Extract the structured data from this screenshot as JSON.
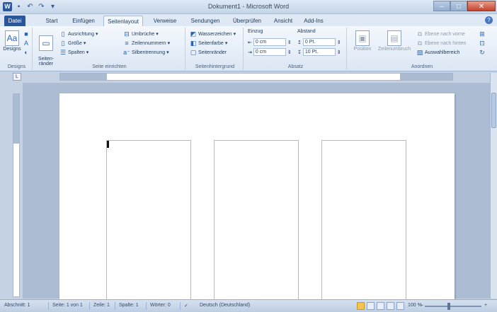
{
  "window": {
    "title": "Dokument1 - Microsoft Word",
    "controls": [
      "–",
      "□",
      "✕"
    ]
  },
  "qat": {
    "logo": "W",
    "items": [
      "save-icon",
      "undo-icon",
      "redo-icon",
      "customize-icon"
    ]
  },
  "tabs": [
    {
      "label": "Datei",
      "name": "tab-datei"
    },
    {
      "label": "Start",
      "name": "tab-start"
    },
    {
      "label": "Einfügen",
      "name": "tab-einfuegen"
    },
    {
      "label": "Seitenlayout",
      "name": "tab-seitenlayout"
    },
    {
      "label": "Verweise",
      "name": "tab-verweise"
    },
    {
      "label": "Sendungen",
      "name": "tab-sendungen"
    },
    {
      "label": "Überprüfen",
      "name": "tab-ueberpruefen"
    },
    {
      "label": "Ansicht",
      "name": "tab-ansicht"
    },
    {
      "label": "Add-Ins",
      "name": "tab-addins"
    }
  ],
  "active_tab": "Seitenlayout",
  "ribbon": {
    "designs": {
      "label": "Designs",
      "button": "Designs"
    },
    "seite_einrichten": {
      "label": "Seite einrichten",
      "seitenraender": "Seiten-\nränder",
      "ausrichtung": "Ausrichtung",
      "groesse": "Größe",
      "spalten": "Spalten",
      "umbrueche": "Umbrüche",
      "zeilennummern": "Zeilennummern",
      "silbentrennung": "Silbentrennung"
    },
    "seitenhintergrund": {
      "label": "Seitenhintergrund",
      "wasserzeichen": "Wasserzeichen",
      "seitenfarbe": "Seitenfarbe",
      "seitenraender": "Seitenränder"
    },
    "absatz": {
      "label": "Absatz",
      "einzug": "Einzug",
      "abstand": "Abstand",
      "einzug_links": "0 cm",
      "einzug_rechts": "0 cm",
      "abstand_vor": "0 Pt.",
      "abstand_nach": "10 Pt."
    },
    "anordnen": {
      "label": "Anordnen",
      "position": "Position",
      "zeilenumbruch": "Zeilenumbruch",
      "ebene_nach_vorne": "Ebene nach vorne",
      "ebene_nach_hinten": "Ebene nach hinten",
      "auswahlbereich": "Auswahlbereich"
    }
  },
  "document": {
    "columns": 3
  },
  "statusbar": {
    "wort": "Wörter: 0",
    "abschnitt": "Abschnitt: 1",
    "seite": "Seite: 1 von 1",
    "zeile": "Zeile: 1",
    "spalte": "Spalte: 1",
    "sprache": "Deutsch (Deutschland)",
    "zoom": "100 %",
    "zoom_minus": "–",
    "zoom_plus": "+"
  },
  "colors": {
    "file_tab": "#2b579a",
    "ribbon_bg": "#f4f8fd",
    "doc_bg": "#abbcd3",
    "close_button": "#c3432c"
  }
}
